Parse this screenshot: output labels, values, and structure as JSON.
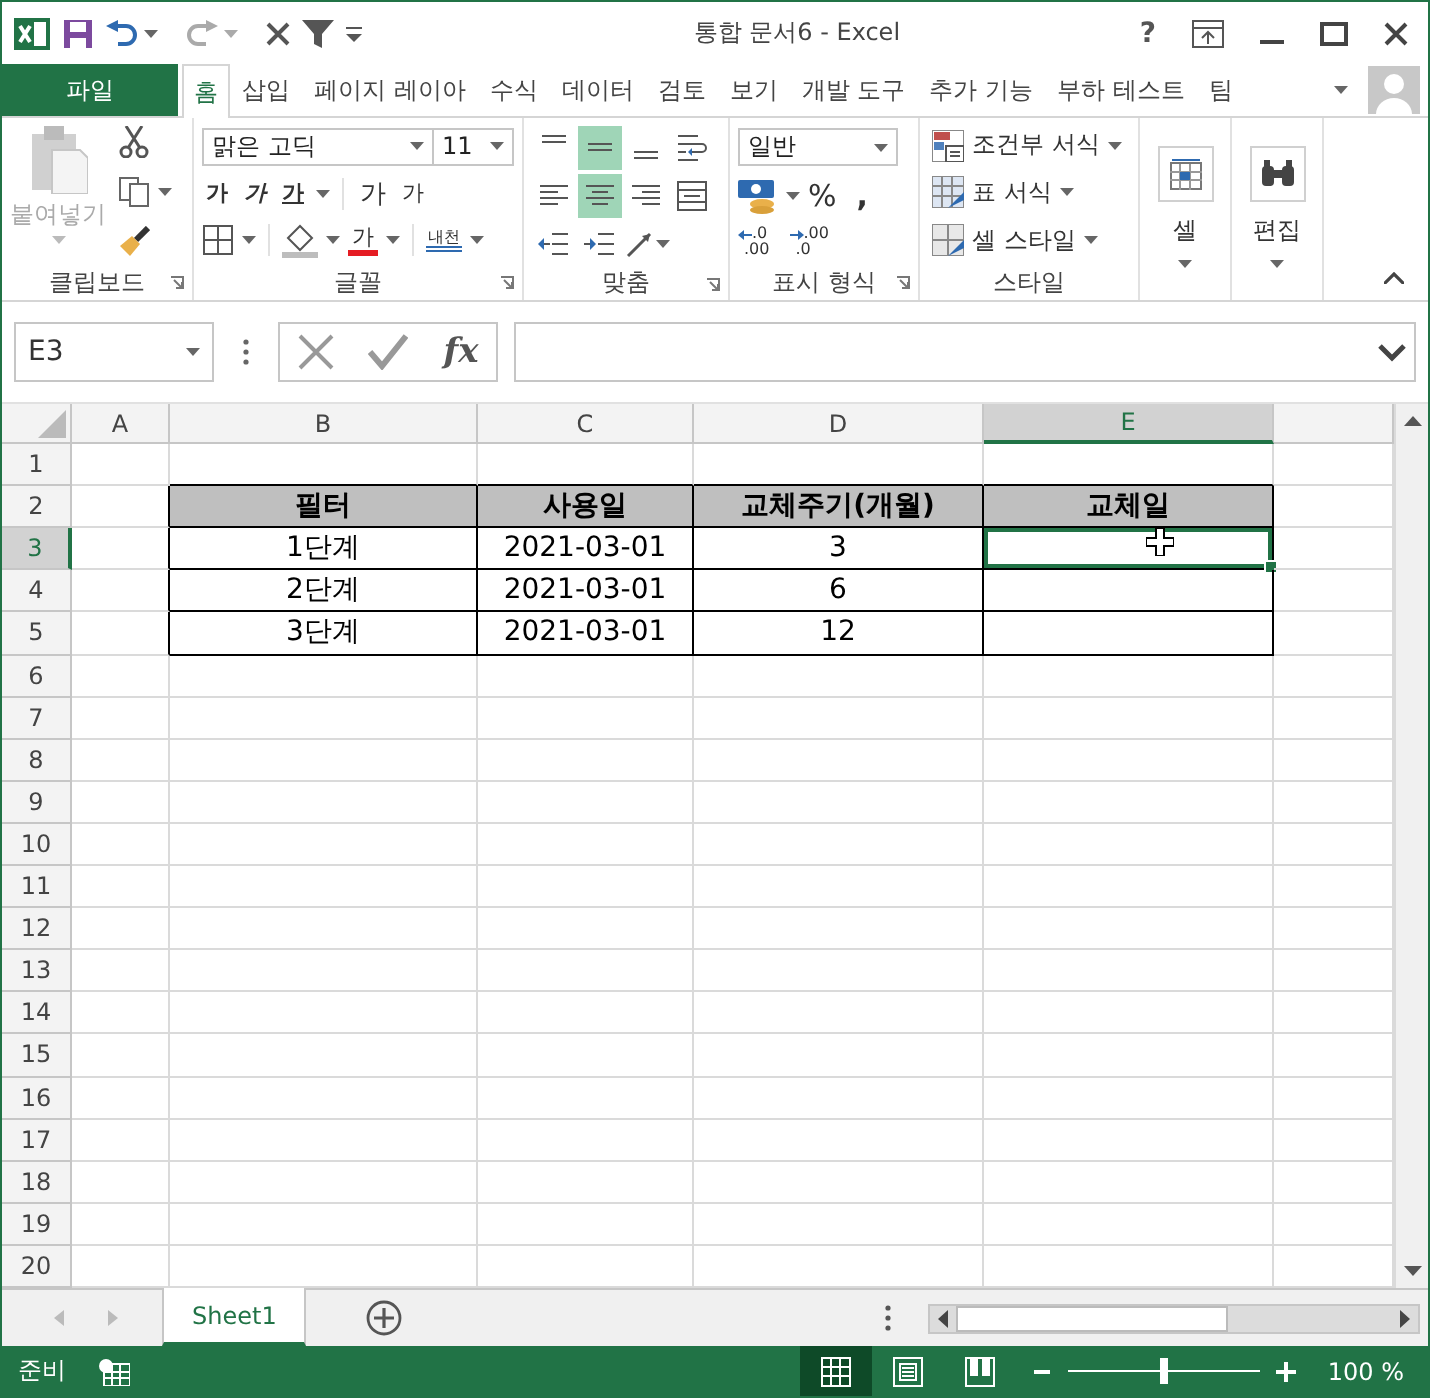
{
  "title_bar": {
    "title": "통합 문서6 - Excel",
    "help": "?"
  },
  "ribbon_tabs": [
    {
      "label": "파일",
      "kind": "file",
      "selected": false
    },
    {
      "label": "홈",
      "kind": "tab",
      "selected": true
    },
    {
      "label": "삽입",
      "kind": "tab",
      "selected": false
    },
    {
      "label": "페이지 레이아",
      "kind": "tab",
      "selected": false
    },
    {
      "label": "수식",
      "kind": "tab",
      "selected": false
    },
    {
      "label": "데이터",
      "kind": "tab",
      "selected": false
    },
    {
      "label": "검토",
      "kind": "tab",
      "selected": false
    },
    {
      "label": "보기",
      "kind": "tab",
      "selected": false
    },
    {
      "label": "개발 도구",
      "kind": "tab",
      "selected": false
    },
    {
      "label": "추가 기능",
      "kind": "tab",
      "selected": false
    },
    {
      "label": "부하 테스트",
      "kind": "tab",
      "selected": false
    },
    {
      "label": "팀",
      "kind": "tab",
      "selected": false
    }
  ],
  "clipboard": {
    "paste": "붙여넣기",
    "label": "클립보드"
  },
  "font": {
    "name": "맑은 고딕",
    "size": "11",
    "bold": "가",
    "italic": "가",
    "underline": "가",
    "grow": "가",
    "shrink": "가",
    "color_letter": "가",
    "phonetic": "내천",
    "label": "글꼴"
  },
  "alignment": {
    "label": "맞춤",
    "buttons": [
      {
        "kind": "top",
        "selected": false
      },
      {
        "kind": "middle",
        "selected": true
      },
      {
        "kind": "bottom",
        "selected": false
      },
      {
        "kind": "wrap",
        "selected": false
      },
      {
        "kind": "left",
        "selected": false
      },
      {
        "kind": "center",
        "selected": true
      },
      {
        "kind": "right",
        "selected": false
      },
      {
        "kind": "merge",
        "selected": false
      },
      {
        "kind": "outdent",
        "selected": false
      },
      {
        "kind": "indent",
        "selected": false
      },
      {
        "kind": "orientation",
        "selected": false
      }
    ]
  },
  "number": {
    "format": "일반",
    "percent": "%",
    "comma": ",",
    "decimals": [
      {
        "upper": ".0",
        "lower": ".00"
      },
      {
        "upper": ".00",
        "lower": ".0"
      }
    ],
    "label": "표시 형식"
  },
  "styles": {
    "items": [
      "조건부 서식",
      "표 서식",
      "셀 스타일"
    ],
    "label": "스타일"
  },
  "cells": {
    "label": "셀"
  },
  "editing": {
    "label": "편집"
  },
  "formula_bar": {
    "name_box": "E3",
    "fx": "fx"
  },
  "sheet": {
    "columns": [
      {
        "label": "A",
        "selected": false
      },
      {
        "label": "B",
        "selected": false
      },
      {
        "label": "C",
        "selected": false
      },
      {
        "label": "D",
        "selected": false
      },
      {
        "label": "E",
        "selected": true
      }
    ],
    "rows": [
      {
        "label": "1",
        "selected": false
      },
      {
        "label": "2",
        "selected": false,
        "cells": [
          {
            "text": "필터",
            "kind": "heading",
            "selected": false
          },
          {
            "text": "사용일",
            "kind": "heading",
            "selected": false
          },
          {
            "text": "교체주기(개월)",
            "kind": "heading",
            "selected": false
          },
          {
            "text": "교체일",
            "kind": "heading",
            "selected": false
          }
        ]
      },
      {
        "label": "3",
        "selected": true,
        "cells": [
          {
            "text": "1단계",
            "kind": "body",
            "selected": false
          },
          {
            "text": "2021-03-01",
            "kind": "body",
            "selected": false
          },
          {
            "text": "3",
            "kind": "body",
            "selected": false
          },
          {
            "kind": "body",
            "selected": true
          }
        ]
      },
      {
        "label": "4",
        "selected": false,
        "cells": [
          {
            "text": "2단계",
            "kind": "body",
            "selected": false
          },
          {
            "text": "2021-03-01",
            "kind": "body",
            "selected": false
          },
          {
            "text": "6",
            "kind": "body",
            "selected": false
          },
          {
            "kind": "body",
            "selected": false
          }
        ]
      },
      {
        "label": "5",
        "selected": false,
        "cells": [
          {
            "text": "3단계",
            "kind": "body",
            "selected": false
          },
          {
            "text": "2021-03-01",
            "kind": "body",
            "selected": false
          },
          {
            "text": "12",
            "kind": "body",
            "selected": false
          },
          {
            "kind": "body",
            "selected": false
          }
        ]
      },
      {
        "label": "6",
        "selected": false
      },
      {
        "label": "7",
        "selected": false
      },
      {
        "label": "8",
        "selected": false
      },
      {
        "label": "9",
        "selected": false
      },
      {
        "label": "10",
        "selected": false
      },
      {
        "label": "11",
        "selected": false
      },
      {
        "label": "12",
        "selected": false
      },
      {
        "label": "13",
        "selected": false
      },
      {
        "label": "14",
        "selected": false
      },
      {
        "label": "15",
        "selected": false
      },
      {
        "label": "16",
        "selected": false
      },
      {
        "label": "17",
        "selected": false
      },
      {
        "label": "18",
        "selected": false
      },
      {
        "label": "19",
        "selected": false
      },
      {
        "label": "20",
        "selected": false
      }
    ]
  },
  "sheet_tabs": [
    {
      "label": "Sheet1",
      "selected": true
    }
  ],
  "status_bar": {
    "status": "준비",
    "views": [
      {
        "kind": "normal",
        "selected": true
      },
      {
        "kind": "page_layout",
        "selected": false
      },
      {
        "kind": "page_break",
        "selected": false
      }
    ],
    "zoom": {
      "level": 0.5,
      "reading": "100 %"
    }
  }
}
